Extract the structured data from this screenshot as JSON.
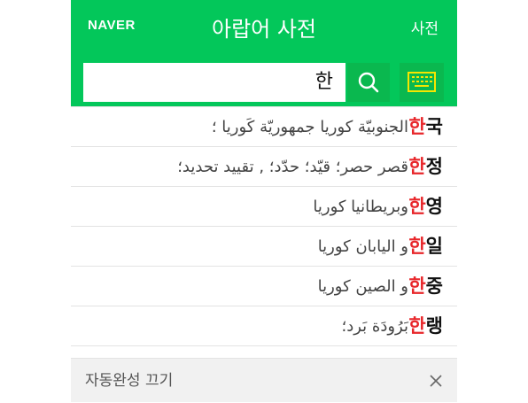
{
  "header": {
    "logo": "NAVER",
    "title": "아랍어 사전",
    "dict_link": "사전"
  },
  "search": {
    "query": "한"
  },
  "suggestions": [
    {
      "highlight": "한",
      "rest": "국",
      "meaning": "الجنوبيّة كوريا جمهوريّة كَوريا ؛"
    },
    {
      "highlight": "한",
      "rest": "정",
      "meaning": "قصر حصر؛ قيّد؛ حدّد؛ , تقييد تحديد؛"
    },
    {
      "highlight": "한",
      "rest": "영",
      "meaning": "وبريطانيا كوريا"
    },
    {
      "highlight": "한",
      "rest": "일",
      "meaning": "و اليابان كوريا"
    },
    {
      "highlight": "한",
      "rest": "중",
      "meaning": "و الصين كوريا"
    },
    {
      "highlight": "한",
      "rest": "랭",
      "meaning": "بَرُودَة بَرد؛"
    }
  ],
  "footer": {
    "autocomplete_off": "자동완성 끄기"
  },
  "colors": {
    "brand": "#03c75a",
    "button": "#0ab84f",
    "highlight": "#e8262a",
    "keyboard_icon": "#f5e600"
  }
}
